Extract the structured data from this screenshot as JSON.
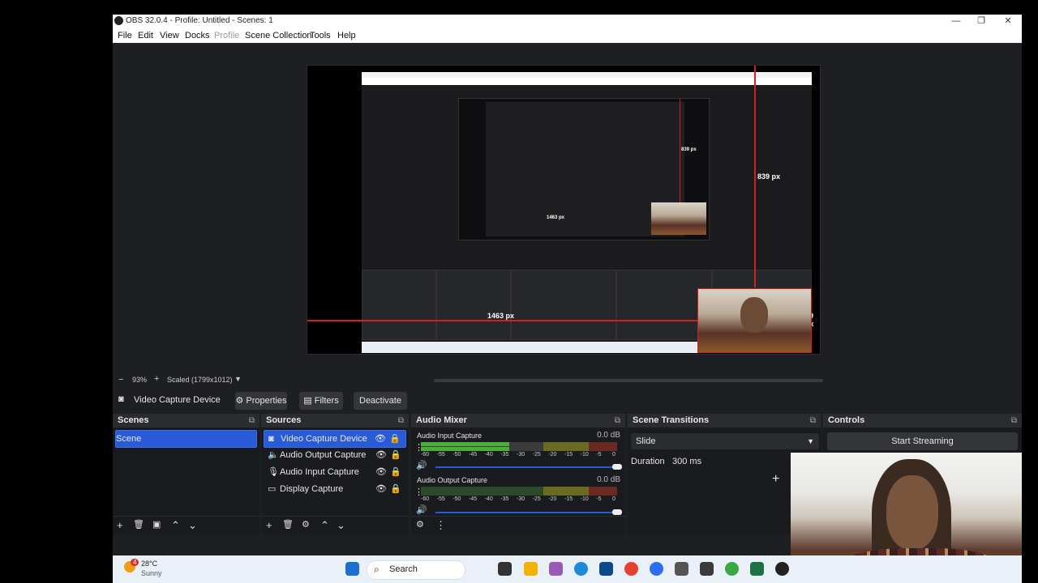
{
  "window": {
    "title": "OBS 32.0.4 - Profile: Untitled - Scenes: 1",
    "controls": {
      "minimize": "—",
      "restore": "❐",
      "close": "✕"
    }
  },
  "menu": [
    "File",
    "Edit",
    "View",
    "Docks",
    "Profile",
    "Scene Collection",
    "Tools",
    "Help"
  ],
  "preview": {
    "measure_vertical": "839 px",
    "measure_horizontal": "1463 px",
    "measure_right": "29 px",
    "inner_vertical": "839 px",
    "inner_horizontal": "1463 px"
  },
  "zoom": {
    "minus": "−",
    "value": "93%",
    "plus": "+",
    "scale_mode": "Scaled (1799x1012)"
  },
  "source_toolbar": {
    "current_source": "Video Capture Device",
    "properties": "Properties",
    "filters": "Filters",
    "deactivate": "Deactivate"
  },
  "scenes": {
    "title": "Scenes",
    "items": [
      "Scene"
    ]
  },
  "sources": {
    "title": "Sources",
    "items": [
      {
        "label": "Video Capture Device",
        "icon": "camera-icon"
      },
      {
        "label": "Audio Output Capture",
        "icon": "speaker-icon"
      },
      {
        "label": "Audio Input Capture",
        "icon": "microphone-icon"
      },
      {
        "label": "Display Capture",
        "icon": "monitor-icon"
      }
    ]
  },
  "audio_mixer": {
    "title": "Audio Mixer",
    "ticks": [
      "-60",
      "-55",
      "-50",
      "-45",
      "-40",
      "-35",
      "-30",
      "-25",
      "-20",
      "-15",
      "-10",
      "-5",
      "0"
    ],
    "channels": [
      {
        "name": "Audio Input Capture",
        "db": "0.0 dB",
        "level": 0.45,
        "volume": 1.0
      },
      {
        "name": "Audio Output Capture",
        "db": "0.0 dB",
        "level": 0.0,
        "volume": 1.0
      }
    ]
  },
  "scene_transitions": {
    "title": "Scene Transitions",
    "transition": "Slide",
    "duration_label": "Duration",
    "duration_value": "300 ms"
  },
  "controls": {
    "title": "Controls",
    "start_streaming": "Start Streaming"
  },
  "taskbar": {
    "weather_temp": "28°C",
    "weather_desc": "Sunny",
    "weather_badge": "4",
    "search": "Search"
  },
  "colors": {
    "accent": "#2a5bd7",
    "dock_bg": "#1a1b1e",
    "header_bg": "#2b2c30",
    "measure": "#d21f1f"
  }
}
